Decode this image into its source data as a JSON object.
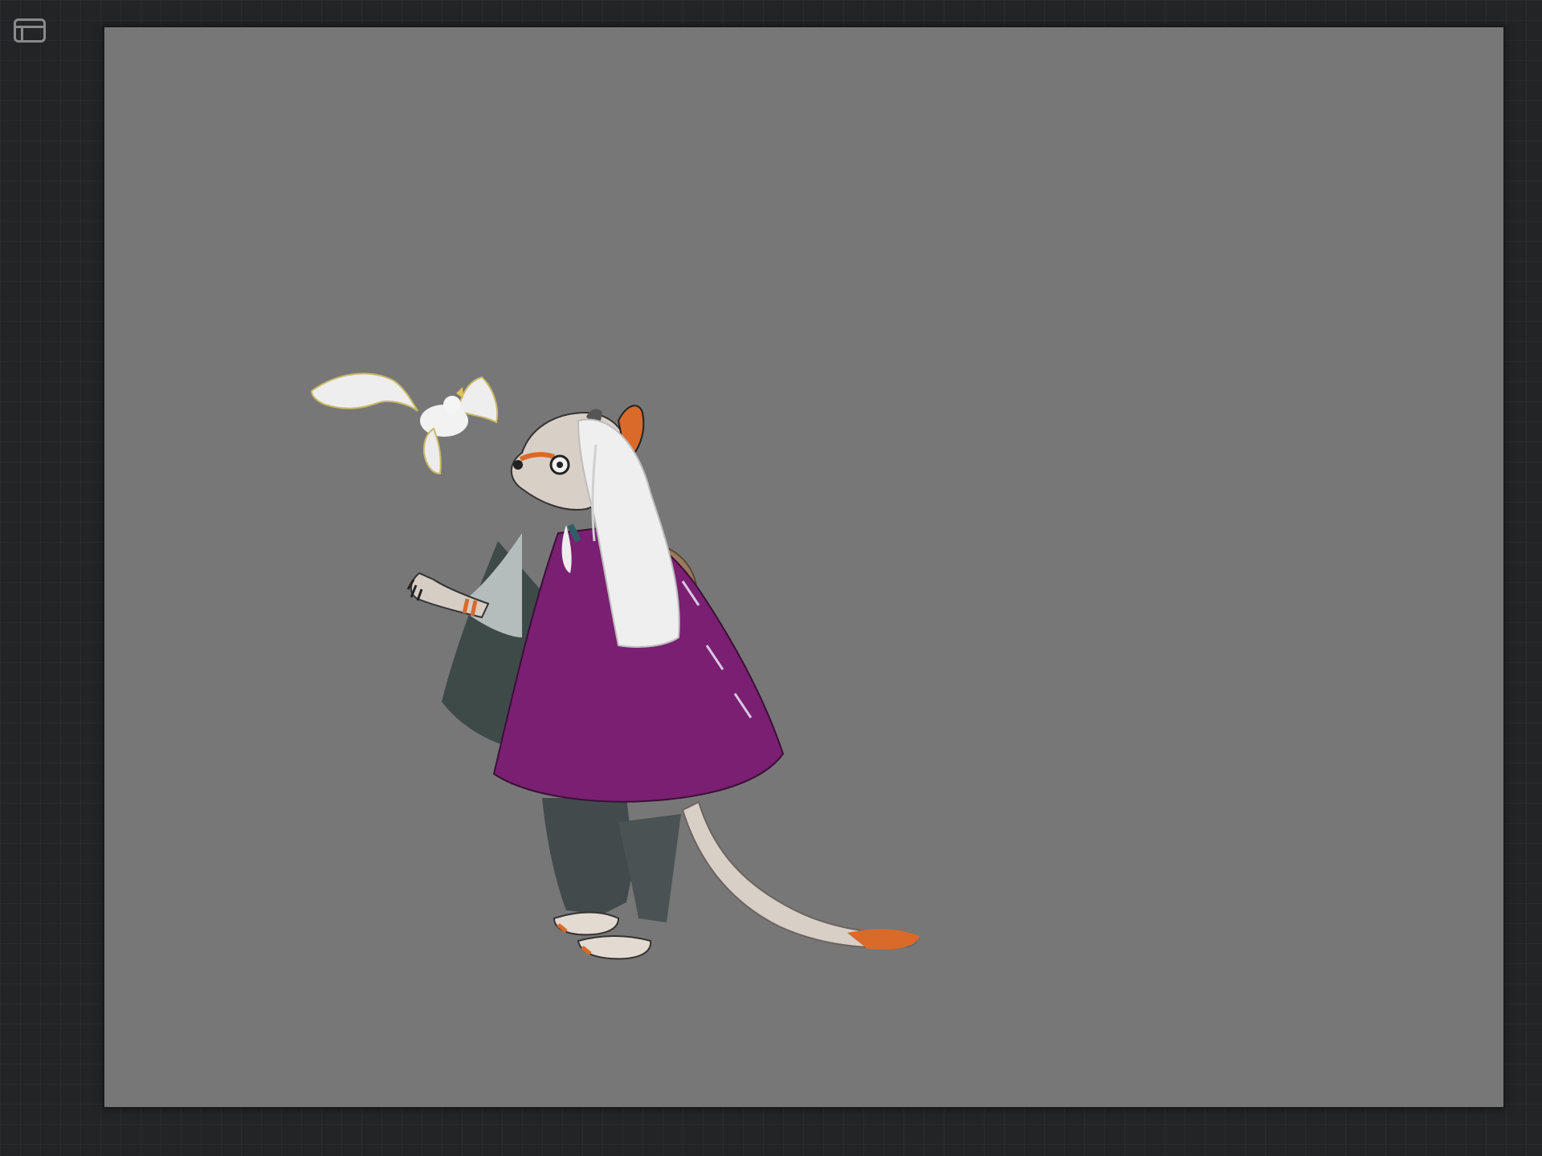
{
  "toolbar": {
    "panel_toggle_icon": "sidebar-panel-icon"
  },
  "canvas": {
    "background": "#777777",
    "artwork": {
      "subjects": [
        "mouse-character",
        "cockatoo"
      ],
      "colors": {
        "cloak": "#7a1f72",
        "hair": "#f0f0f0",
        "fur": "#d8cfc6",
        "accent": "#d96a2a",
        "trousers": "#434a4c"
      }
    }
  }
}
